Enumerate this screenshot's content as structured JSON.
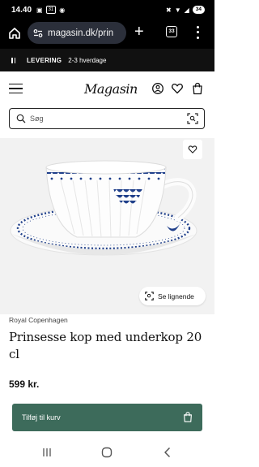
{
  "status_bar": {
    "time": "14.40",
    "badge": "31",
    "battery": "34"
  },
  "browser": {
    "url": "magasin.dk/prin",
    "tab_count": "33",
    "icons": [
      "home-icon",
      "site-settings-icon",
      "new-tab-icon",
      "tab-switcher-icon",
      "overflow-menu-icon"
    ]
  },
  "delivery": {
    "label": "LEVERING",
    "text": "2-3 hverdage"
  },
  "header": {
    "logo": "Magasin",
    "icons": [
      "hamburger-menu-icon",
      "account-icon",
      "wishlist-heart-icon",
      "shopping-bag-icon"
    ]
  },
  "search": {
    "placeholder": "Søg"
  },
  "product": {
    "similar_label": "Se lignende",
    "brand": "Royal Copenhagen",
    "title": "Prinsesse kop med underkop 20 cl",
    "price": "599 kr."
  },
  "cart": {
    "label": "Tilføj til kurv"
  },
  "colors": {
    "cart_button": "#3d6b5b",
    "pattern_blue": "#1f3f8a",
    "image_background": "#f2f2f2"
  }
}
